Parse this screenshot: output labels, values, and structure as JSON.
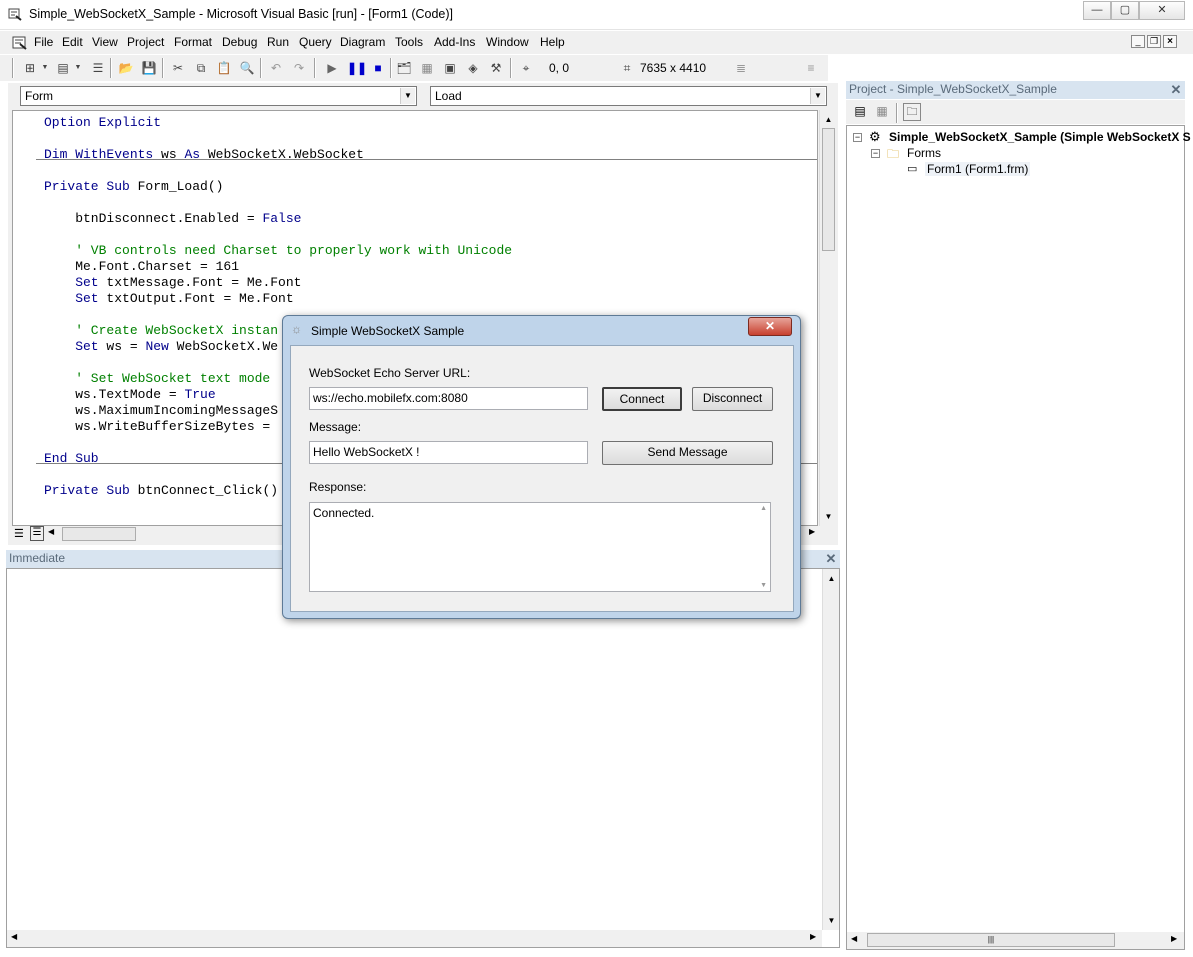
{
  "window": {
    "title": "Simple_WebSocketX_Sample - Microsoft Visual Basic [run] - [Form1 (Code)]",
    "min_glyph": "—",
    "max_glyph": "▢",
    "close_glyph": "✕"
  },
  "menu": [
    "File",
    "Edit",
    "View",
    "Project",
    "Format",
    "Debug",
    "Run",
    "Query",
    "Diagram",
    "Tools",
    "Add-Ins",
    "Window",
    "Help"
  ],
  "toolbar": {
    "position": "0, 0",
    "size": "7635 x 4410"
  },
  "code_window": {
    "object_combo": "Form",
    "procedure_combo": "Load",
    "lines": [
      {
        "segs": [
          {
            "t": "Option Explicit",
            "c": "kw"
          }
        ]
      },
      {
        "segs": [
          {
            "t": "",
            "c": ""
          }
        ]
      },
      {
        "segs": [
          {
            "t": "Dim WithEvents ",
            "c": "kw"
          },
          {
            "t": "ws ",
            "c": ""
          },
          {
            "t": "As ",
            "c": "kw"
          },
          {
            "t": "WebSocketX.WebSocket",
            "c": ""
          }
        ]
      },
      {
        "segs": [
          {
            "t": "",
            "c": ""
          }
        ]
      },
      {
        "segs": [
          {
            "t": "Private Sub ",
            "c": "kw"
          },
          {
            "t": "Form_Load()",
            "c": ""
          }
        ]
      },
      {
        "segs": [
          {
            "t": "",
            "c": ""
          }
        ]
      },
      {
        "segs": [
          {
            "t": "    btnDisconnect.Enabled = ",
            "c": ""
          },
          {
            "t": "False",
            "c": "kw"
          }
        ]
      },
      {
        "segs": [
          {
            "t": "",
            "c": ""
          }
        ]
      },
      {
        "segs": [
          {
            "t": "    ' VB controls need Charset to properly work with Unicode",
            "c": "cm"
          }
        ]
      },
      {
        "segs": [
          {
            "t": "    Me.Font.Charset = 161",
            "c": ""
          }
        ]
      },
      {
        "segs": [
          {
            "t": "    Set ",
            "c": "kw"
          },
          {
            "t": "txtMessage.Font = Me.Font",
            "c": ""
          }
        ]
      },
      {
        "segs": [
          {
            "t": "    Set ",
            "c": "kw"
          },
          {
            "t": "txtOutput.Font = Me.Font",
            "c": ""
          }
        ]
      },
      {
        "segs": [
          {
            "t": "",
            "c": ""
          }
        ]
      },
      {
        "segs": [
          {
            "t": "    ' Create WebSocketX instan",
            "c": "cm"
          }
        ]
      },
      {
        "segs": [
          {
            "t": "    Set ",
            "c": "kw"
          },
          {
            "t": "ws = ",
            "c": ""
          },
          {
            "t": "New ",
            "c": "kw"
          },
          {
            "t": "WebSocketX.We",
            "c": ""
          }
        ]
      },
      {
        "segs": [
          {
            "t": "",
            "c": ""
          }
        ]
      },
      {
        "segs": [
          {
            "t": "    ' Set WebSocket text mode",
            "c": "cm"
          }
        ]
      },
      {
        "segs": [
          {
            "t": "    ws.TextMode = ",
            "c": ""
          },
          {
            "t": "True",
            "c": "kw"
          }
        ]
      },
      {
        "segs": [
          {
            "t": "    ws.MaximumIncomingMessageS",
            "c": ""
          }
        ]
      },
      {
        "segs": [
          {
            "t": "    ws.WriteBufferSizeBytes = ",
            "c": ""
          }
        ]
      },
      {
        "segs": [
          {
            "t": "",
            "c": ""
          }
        ]
      },
      {
        "segs": [
          {
            "t": "End Sub",
            "c": "kw"
          }
        ]
      },
      {
        "segs": [
          {
            "t": "",
            "c": ""
          }
        ]
      },
      {
        "segs": [
          {
            "t": "Private Sub ",
            "c": "kw"
          },
          {
            "t": "btnConnect_Click()",
            "c": ""
          }
        ]
      }
    ]
  },
  "immediate": {
    "title": "Immediate"
  },
  "project": {
    "title": "Project - Simple_WebSocketX_Sample",
    "root": "Simple_WebSocketX_Sample (Simple WebSocketX S",
    "folder": "Forms",
    "item": "Form1 (Form1.frm)"
  },
  "dialog": {
    "title": "Simple WebSocketX Sample",
    "close_glyph": "✕",
    "url_label": "WebSocket Echo Server URL:",
    "url_value": "ws://echo.mobilefx.com:8080",
    "connect_label": "Connect",
    "disconnect_label": "Disconnect",
    "message_label": "Message:",
    "message_value": "Hello WebSocketX !",
    "send_label": "Send Message",
    "response_label": "Response:",
    "response_value": "Connected."
  }
}
